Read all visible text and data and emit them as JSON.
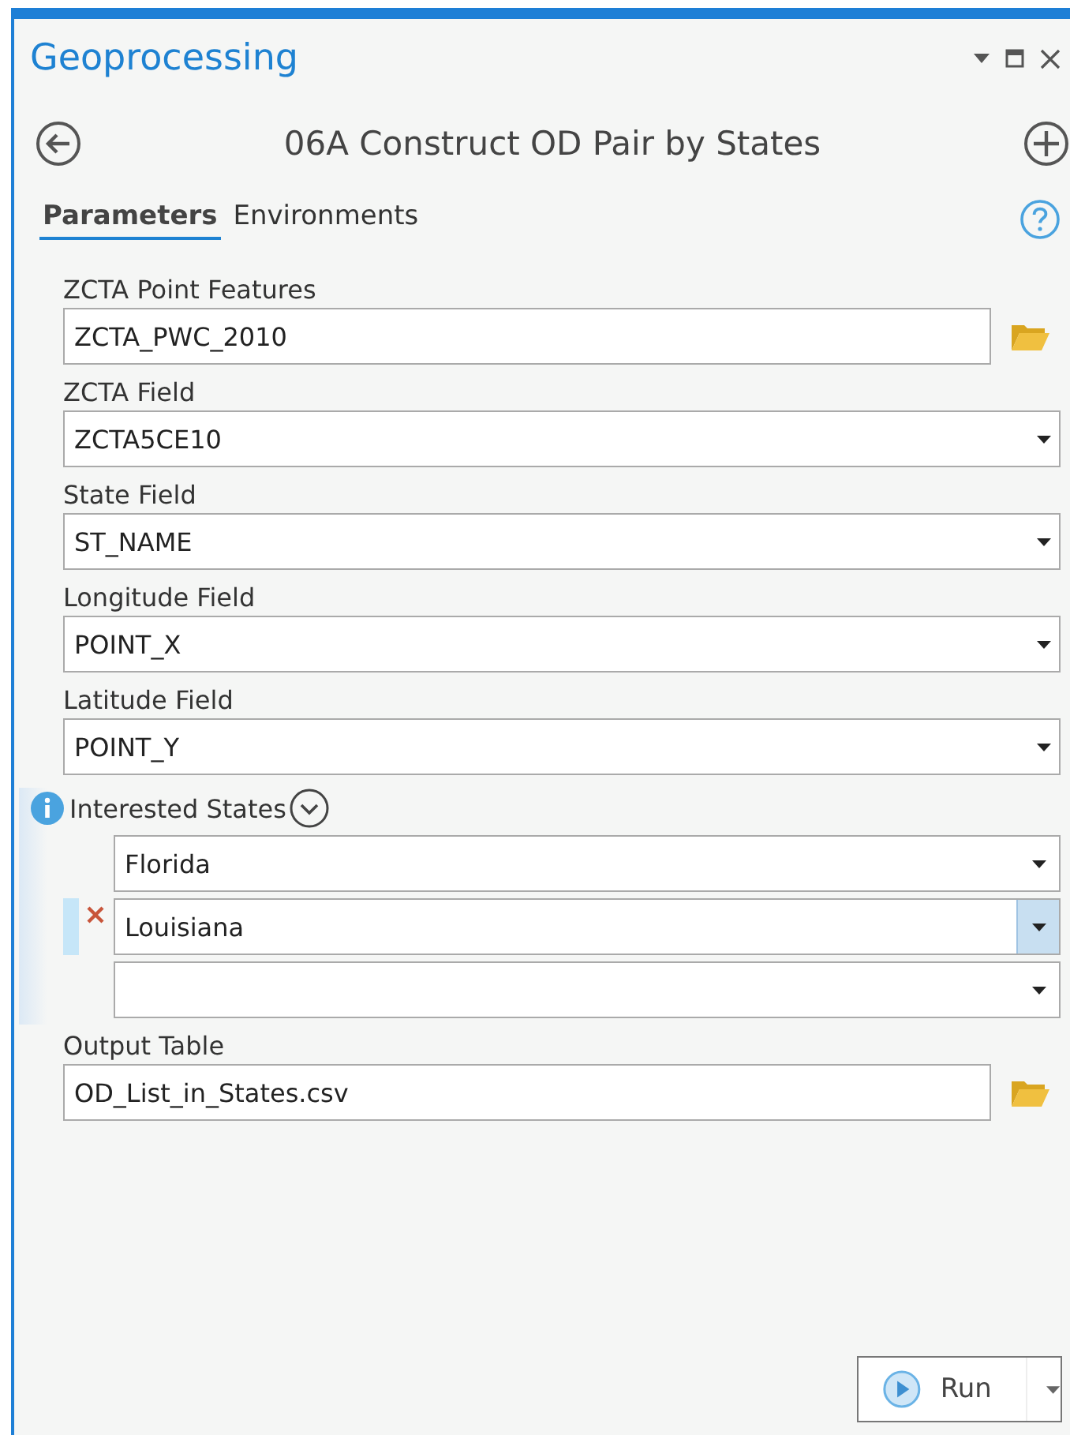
{
  "window": {
    "title": "Geoprocessing"
  },
  "tool": {
    "title": "06A Construct OD Pair by States"
  },
  "tabs": [
    {
      "label": "Parameters",
      "selected": true
    },
    {
      "label": "Environments",
      "selected": false
    }
  ],
  "parameters": [
    {
      "kind": "file",
      "label": "ZCTA Point Features",
      "value": "ZCTA_PWC_2010"
    },
    {
      "kind": "dropdown",
      "label": "ZCTA Field",
      "value": "ZCTA5CE10"
    },
    {
      "kind": "dropdown",
      "label": "State Field",
      "value": "ST_NAME"
    },
    {
      "kind": "dropdown",
      "label": "Longitude Field",
      "value": "POINT_X"
    },
    {
      "kind": "dropdown",
      "label": "Latitude Field",
      "value": "POINT_Y"
    },
    {
      "kind": "multivalue",
      "label": "Interested States",
      "values": [
        {
          "value": "Florida",
          "selected": false
        },
        {
          "value": "Louisiana",
          "selected": true
        },
        {
          "selected": false
        }
      ]
    },
    {
      "kind": "file",
      "label": "Output Table",
      "value": "OD_List_in_States.csv"
    }
  ],
  "run_button": {
    "label": "Run"
  }
}
